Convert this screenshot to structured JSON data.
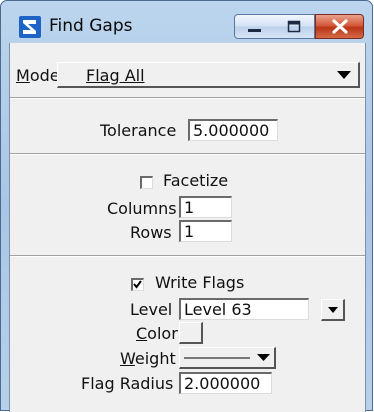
{
  "window": {
    "title": "Find Gaps"
  },
  "mode": {
    "label_first": "M",
    "label_rest": "ode",
    "value": "Flag All"
  },
  "tolerance": {
    "label": "Tolerance",
    "value": "5.000000"
  },
  "facetize": {
    "label": "Facetize",
    "checked": false
  },
  "columns": {
    "label": "Columns",
    "value": "1"
  },
  "rows": {
    "label": "Rows",
    "value": "1"
  },
  "write_flags": {
    "label": "Write Flags",
    "checked": true
  },
  "level": {
    "label": "Level",
    "value": "Level 63"
  },
  "color": {
    "label_first": "C",
    "label_rest": "olor"
  },
  "weight": {
    "label_first": "W",
    "label_rest": "eight"
  },
  "flag_radius": {
    "label": "Flag Radius",
    "value": "2.000000"
  },
  "icons": {
    "app": "microstation-icon",
    "minimize": "minimize-icon",
    "maximize": "maximize-icon",
    "close": "close-icon",
    "dropdown": "chevron-down-icon",
    "check": "checkmark-icon"
  }
}
